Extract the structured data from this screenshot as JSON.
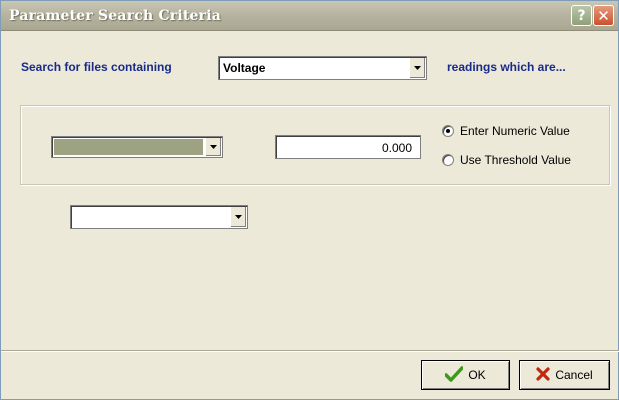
{
  "window": {
    "title": "Parameter Search Criteria",
    "help_glyph": "?",
    "close_glyph": "✕"
  },
  "search": {
    "label": "Search for files containing",
    "parameter_value": "Voltage",
    "suffix_label": "readings which are..."
  },
  "criteria": {
    "operator_value": "",
    "numeric_value": "0.000",
    "options": [
      {
        "label": "Enter Numeric Value",
        "checked": true
      },
      {
        "label": "Use Threshold Value",
        "checked": false
      }
    ],
    "second_value": ""
  },
  "buttons": {
    "ok_label": "OK",
    "cancel_label": "Cancel"
  },
  "colors": {
    "label_blue": "#1a2a8a",
    "operator_fill": "#9da283",
    "ok_check": "#3a9a1a",
    "cancel_x": "#c2260e"
  }
}
